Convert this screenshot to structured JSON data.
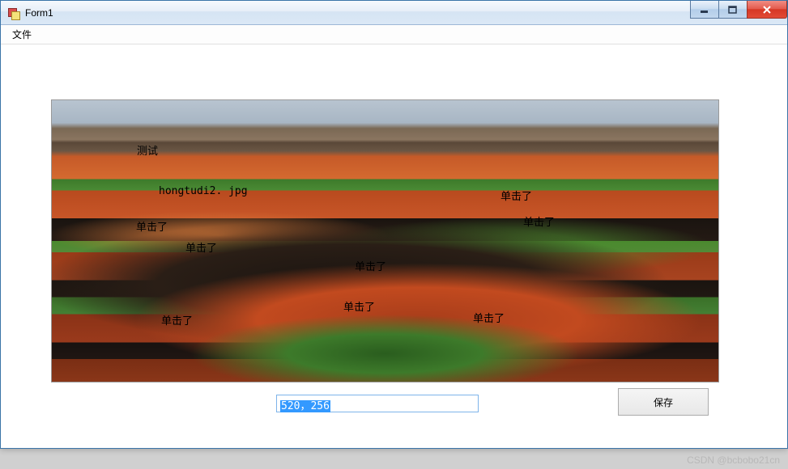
{
  "window": {
    "title": "Form1"
  },
  "menu": {
    "file": "文件"
  },
  "overlays": {
    "test": "测试",
    "filename": "hongtudi2. jpg",
    "click1": "单击了",
    "click2": "单击了",
    "click3": "单击了",
    "click4": "单击了",
    "click5": "单击了",
    "click6": "单击了",
    "click7": "单击了",
    "click8": "单击了"
  },
  "textbox": {
    "value": "520，256"
  },
  "button": {
    "save": "保存"
  },
  "watermark": "CSDN @bcbobo21cn"
}
